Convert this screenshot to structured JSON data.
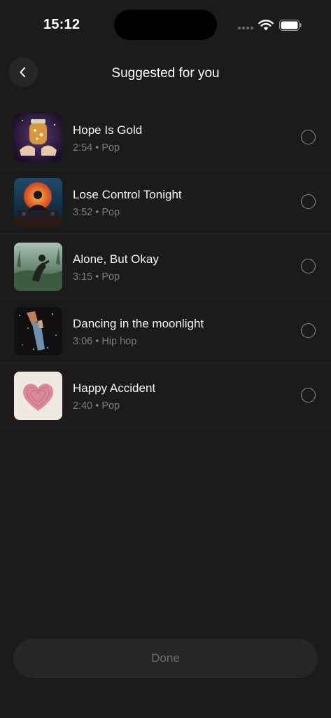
{
  "status_bar": {
    "time": "15:12",
    "icons": [
      "signal-dots-icon",
      "wifi-icon",
      "battery-icon"
    ]
  },
  "header": {
    "back_icon": "chevron-left-icon",
    "title": "Suggested for you"
  },
  "songs": [
    {
      "title": "Hope Is Gold",
      "duration": "2:54",
      "genre": "Pop",
      "selected": false
    },
    {
      "title": "Lose Control Tonight",
      "duration": "3:52",
      "genre": "Pop",
      "selected": false
    },
    {
      "title": "Alone, But Okay",
      "duration": "3:15",
      "genre": "Pop",
      "selected": false
    },
    {
      "title": "Dancing in the moonlight",
      "duration": "3:06",
      "genre": "Hip hop",
      "selected": false
    },
    {
      "title": "Happy Accident",
      "duration": "2:40",
      "genre": "Pop",
      "selected": false
    }
  ],
  "meta_separator": "•",
  "footer": {
    "done_label": "Done"
  },
  "colors": {
    "background": "#1b1b1b",
    "surface": "#262626",
    "text_primary": "#ffffff",
    "text_secondary": "#7d7d7d",
    "disabled_text": "#6f6f6f"
  }
}
